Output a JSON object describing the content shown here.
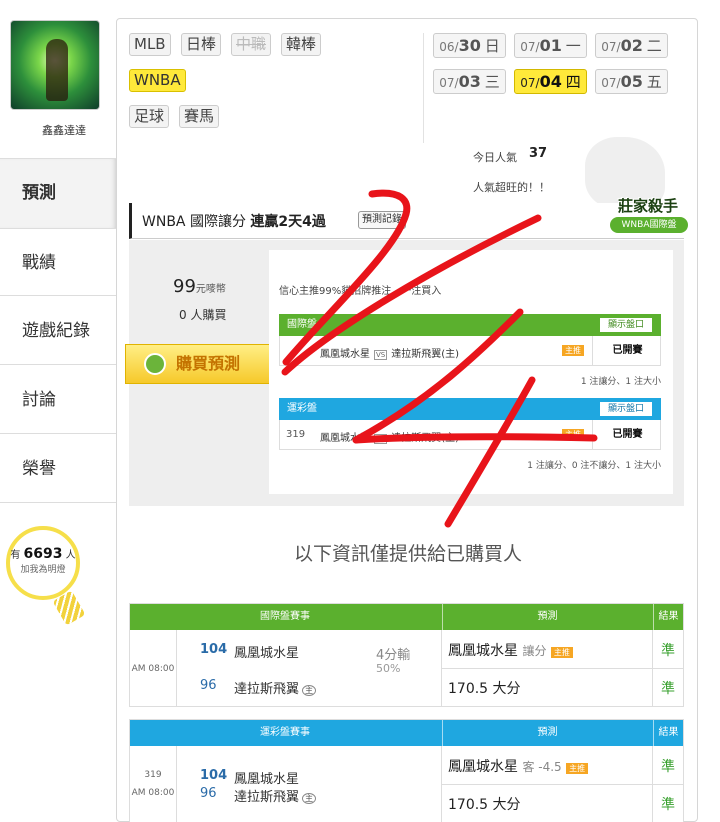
{
  "user": {
    "name": "鑫鑫達達"
  },
  "nav": {
    "predict": "預測",
    "record": "戰績",
    "games": "遊戲紀錄",
    "discuss": "討論",
    "honor": "榮譽"
  },
  "fans": {
    "prefix": "有",
    "count": "6693",
    "suffix": "人",
    "line2": "加我為明燈"
  },
  "sports": [
    {
      "label": "MLB",
      "state": "normal"
    },
    {
      "label": "日棒",
      "state": "normal"
    },
    {
      "label": "中職",
      "state": "disabled"
    },
    {
      "label": "韓棒",
      "state": "normal"
    },
    {
      "label": "WNBA",
      "state": "active"
    },
    {
      "label": "足球",
      "state": "normal"
    },
    {
      "label": "賽馬",
      "state": "normal"
    }
  ],
  "dates": [
    {
      "md": "06/",
      "day": "30",
      "wd": "日",
      "active": false
    },
    {
      "md": "07/",
      "day": "01",
      "wd": "一",
      "active": false
    },
    {
      "md": "07/",
      "day": "02",
      "wd": "二",
      "active": false
    },
    {
      "md": "07/",
      "day": "03",
      "wd": "三",
      "active": false
    },
    {
      "md": "07/",
      "day": "04",
      "wd": "四",
      "active": true
    },
    {
      "md": "07/",
      "day": "05",
      "wd": "五",
      "active": false
    }
  ],
  "popularity": {
    "label": "今日人氣",
    "count": "37",
    "text": "人氣超旺的！！"
  },
  "offer": {
    "title_prefix": "WNBA 國際讓分",
    "streak": "連贏2天4過",
    "record_btn": "預測記錄",
    "badge_main": "莊家殺手",
    "badge_sub": "WNBA國際盤",
    "price": "99",
    "price_unit": "元嘜幣",
    "buyers": "0 人購買",
    "buy_label": "購買預測",
    "note": "信心主推99%貓招牌推注，一注買入",
    "sections": [
      {
        "title": "國際盤",
        "show_btn": "顯示盤口",
        "num": "",
        "away": "鳳凰城水星",
        "vs": "VS",
        "home": "達拉斯飛翼(主)",
        "tag": "主推",
        "status": "已開賽",
        "footer": "1 注讓分、1 注大小"
      },
      {
        "title": "運彩盤",
        "show_btn": "顯示盤口",
        "num": "319",
        "away": "鳳凰城水星",
        "vs": "VS",
        "home": "達拉斯飛翼(主)",
        "tag": "主推",
        "status": "已開賽",
        "footer": "1 注讓分、0 注不讓分、1 注大小"
      }
    ]
  },
  "notice": "以下資訊僅提供給已購買人",
  "tables": [
    {
      "head_game": "國際盤賽事",
      "head_pred": "預測",
      "head_result": "結果",
      "num": "",
      "time": "AM 08:00",
      "away_score": "104",
      "away_team": "鳳凰城水星",
      "home_score": "96",
      "home_team": "達拉斯飛翼",
      "home_mark": "主",
      "margin": "4分輸",
      "margin_pct": "50%",
      "pred1": "鳳凰城水星",
      "pred1_sub": "讓分",
      "pred1_tag": "主推",
      "result1": "準",
      "pred2": "170.5 大分",
      "result2": "準"
    },
    {
      "head_game": "運彩盤賽事",
      "head_pred": "預測",
      "head_result": "結果",
      "num": "319",
      "time": "AM 08:00",
      "away_score": "104",
      "away_team": "鳳凰城水星",
      "home_score": "96",
      "home_team": "達拉斯飛翼",
      "home_mark": "主",
      "pred1": "鳳凰城水星",
      "pred1_sub": "客 -4.5",
      "pred1_tag": "主推",
      "result1": "準",
      "pred2": "170.5 大分",
      "result2": "準"
    }
  ],
  "colors": {
    "accent_yellow": "#ffe93a",
    "green": "#5bb02e",
    "blue": "#1fa7e0",
    "scribble_red": "#e8141a",
    "result_green": "#39a12f"
  }
}
